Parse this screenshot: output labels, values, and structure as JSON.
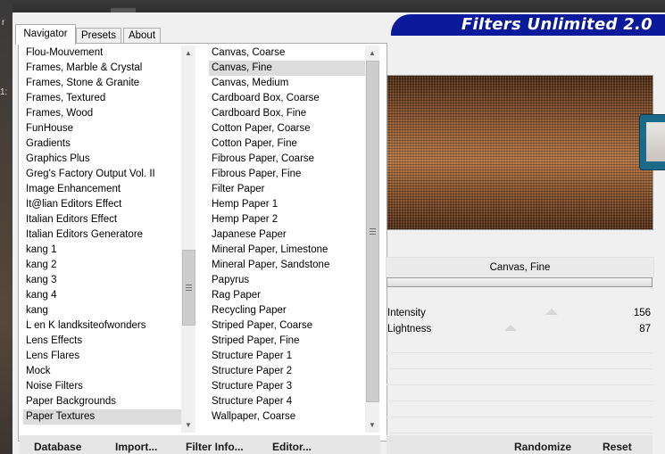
{
  "app": {
    "title": "Filters Unlimited 2.0",
    "accent_color": "#0a1a9a"
  },
  "desktop": {
    "left_text_1": "r",
    "left_text_2": "1:"
  },
  "tabs": [
    {
      "label": "Navigator",
      "active": true
    },
    {
      "label": "Presets",
      "active": false
    },
    {
      "label": "About",
      "active": false
    }
  ],
  "categories": [
    "Flou-Mouvement",
    "Frames, Marble & Crystal",
    "Frames, Stone & Granite",
    "Frames, Textured",
    "Frames, Wood",
    "FunHouse",
    "Gradients",
    "Graphics Plus",
    "Greg's Factory Output Vol. II",
    "Image Enhancement",
    "It@lian Editors Effect",
    "Italian Editors Effect",
    "Italian Editors Generatore",
    "kang 1",
    "kang 2",
    "kang 3",
    "kang 4",
    "kang",
    "L en K landksiteofwonders",
    "Lens Effects",
    "Lens Flares",
    "Mock",
    "Noise Filters",
    "Paper Backgrounds",
    "Paper Textures"
  ],
  "selected_category": "Paper Textures",
  "filters": [
    "Canvas, Coarse",
    "Canvas, Fine",
    "Canvas, Medium",
    "Cardboard Box, Coarse",
    "Cardboard Box, Fine",
    "Cotton Paper, Coarse",
    "Cotton Paper, Fine",
    "Fibrous Paper, Coarse",
    "Fibrous Paper, Fine",
    "Filter Paper",
    "Hemp Paper 1",
    "Hemp Paper 2",
    "Japanese Paper",
    "Mineral Paper, Limestone",
    "Mineral Paper, Sandstone",
    "Papyrus",
    "Rag Paper",
    "Recycling Paper",
    "Striped Paper, Coarse",
    "Striped Paper, Fine",
    "Structure Paper 1",
    "Structure Paper 2",
    "Structure Paper 3",
    "Structure Paper 4",
    "Wallpaper, Coarse"
  ],
  "selected_filter": "Canvas, Fine",
  "preview": {
    "texture": "brown canvas texture"
  },
  "params": [
    {
      "label": "Intensity",
      "value": "156",
      "level": 0.61
    },
    {
      "label": "Lightness",
      "value": "87",
      "level": 0.34
    }
  ],
  "buttons": {
    "database": "Database",
    "import": "Import...",
    "filter_info": "Filter Info...",
    "editor": "Editor...",
    "randomize": "Randomize",
    "reset": "Reset"
  }
}
